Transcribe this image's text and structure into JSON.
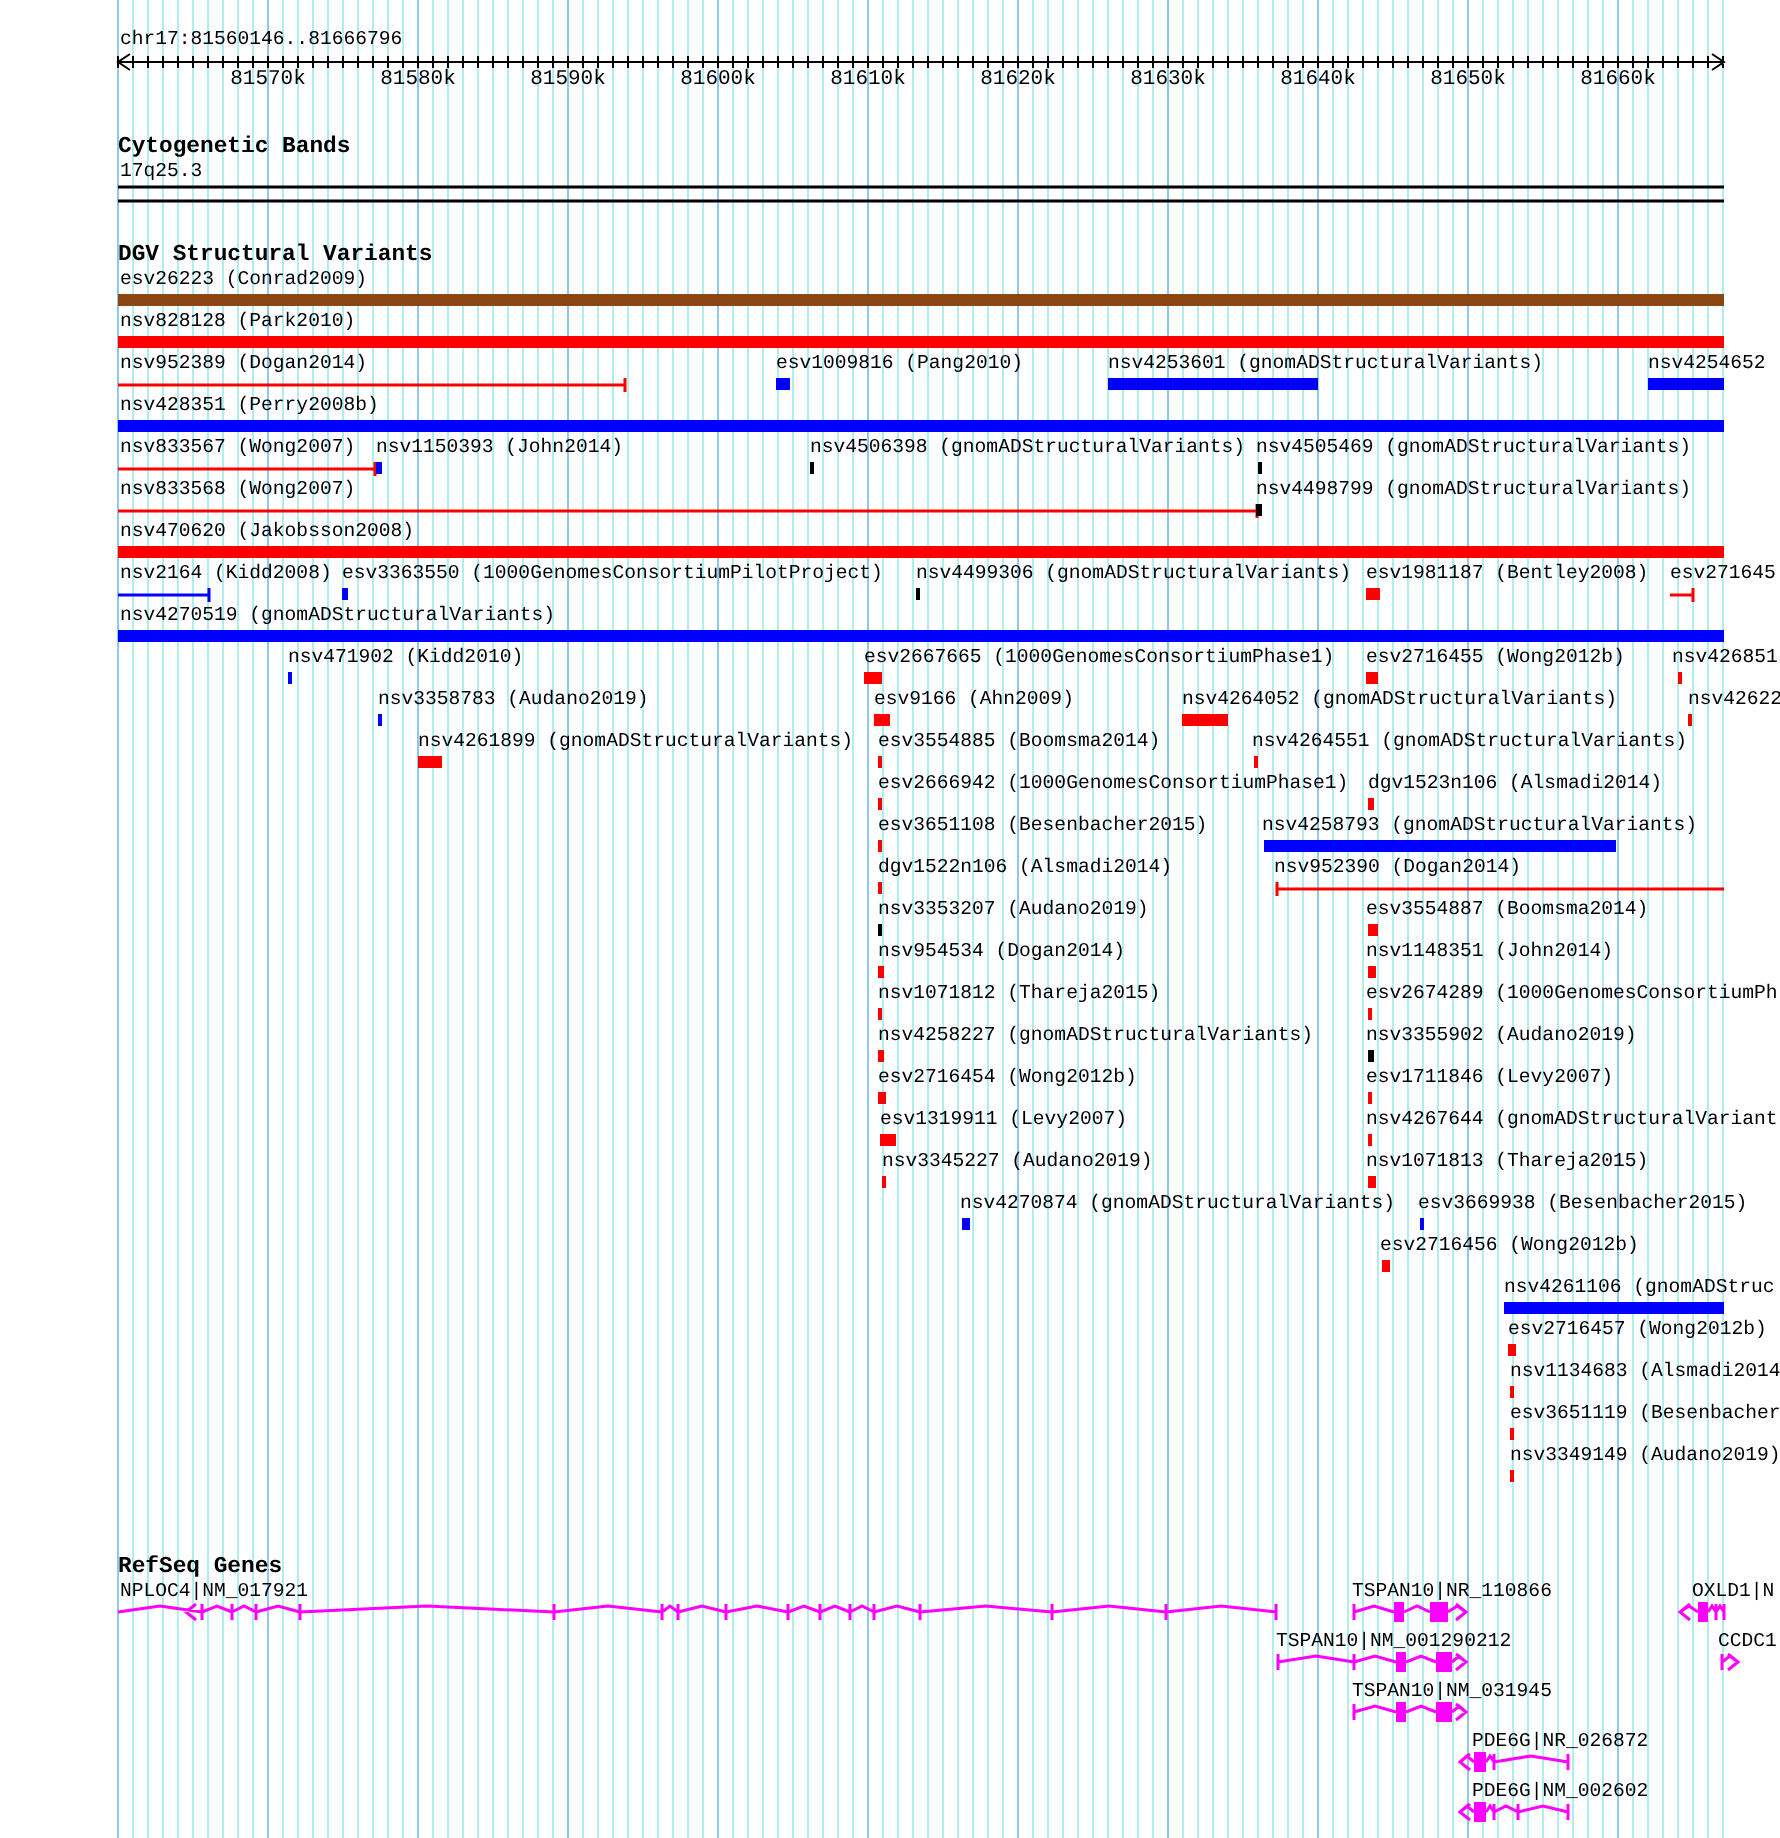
{
  "locus": "chr17:81560146..81666796",
  "ruler": {
    "ticks": [
      "81570k",
      "81580k",
      "81590k",
      "81600k",
      "81610k",
      "81620k",
      "81630k",
      "81640k",
      "81650k",
      "81660k"
    ]
  },
  "tracks": [
    {
      "title": "Cytogenetic Bands",
      "features": [
        {
          "label": "17q25.3"
        }
      ]
    },
    {
      "title": "DGV Structural Variants",
      "features": [
        {
          "label": "esv26223 (Conrad2009)",
          "color": "#8b4513"
        },
        {
          "label": "nsv828128 (Park2010)",
          "color": "#ff0000"
        },
        {
          "label": "nsv952389 (Dogan2014)",
          "color": "#ff0000"
        },
        {
          "label": "esv1009816 (Pang2010)",
          "color": "#0000ff"
        },
        {
          "label": "nsv4253601 (gnomADStructuralVariants)",
          "color": "#0000ff"
        },
        {
          "label": "nsv4254652",
          "color": "#0000ff"
        },
        {
          "label": "nsv428351 (Perry2008b)",
          "color": "#0000ff"
        },
        {
          "label": "nsv833567 (Wong2007)",
          "color": "#ff0000"
        },
        {
          "label": "nsv1150393 (John2014)",
          "color": "#0000ff"
        },
        {
          "label": "nsv4506398 (gnomADStructuralVariants)",
          "color": "#000000"
        },
        {
          "label": "nsv4505469 (gnomADStructuralVariants)",
          "color": "#000000"
        },
        {
          "label": "nsv833568 (Wong2007)",
          "color": "#ff0000"
        },
        {
          "label": "nsv4498799 (gnomADStructuralVariants)",
          "color": "#000000"
        },
        {
          "label": "nsv470620 (Jakobsson2008)",
          "color": "#ff0000"
        },
        {
          "label": "nsv2164 (Kidd2008)",
          "color": "#0000ff"
        },
        {
          "label": "esv3363550 (1000GenomesConsortiumPilotProject)",
          "color": "#0000ff"
        },
        {
          "label": "nsv4499306 (gnomADStructuralVariants)",
          "color": "#000000"
        },
        {
          "label": "esv1981187 (Bentley2008)",
          "color": "#ff0000"
        },
        {
          "label": "esv271645",
          "color": "#ff0000"
        },
        {
          "label": "nsv4270519 (gnomADStructuralVariants)",
          "color": "#0000ff"
        },
        {
          "label": "nsv471902 (Kidd2010)",
          "color": "#0000ff"
        },
        {
          "label": "esv2667665 (1000GenomesConsortiumPhase1)",
          "color": "#ff0000"
        },
        {
          "label": "esv2716455 (Wong2012b)",
          "color": "#ff0000"
        },
        {
          "label": "nsv426851",
          "color": "#ff0000"
        },
        {
          "label": "nsv3358783 (Audano2019)",
          "color": "#0000ff"
        },
        {
          "label": "esv9166 (Ahn2009)",
          "color": "#ff0000"
        },
        {
          "label": "nsv4264052 (gnomADStructuralVariants)",
          "color": "#ff0000"
        },
        {
          "label": "nsv42622",
          "color": "#ff0000"
        },
        {
          "label": "nsv4261899 (gnomADStructuralVariants)",
          "color": "#ff0000"
        },
        {
          "label": "esv3554885 (Boomsma2014)",
          "color": "#ff0000"
        },
        {
          "label": "nsv4264551 (gnomADStructuralVariants)",
          "color": "#ff0000"
        },
        {
          "label": "esv2666942 (1000GenomesConsortiumPhase1)",
          "color": "#ff0000"
        },
        {
          "label": "dgv1523n106 (Alsmadi2014)",
          "color": "#ff0000"
        },
        {
          "label": "esv3651108 (Besenbacher2015)",
          "color": "#ff0000"
        },
        {
          "label": "nsv4258793 (gnomADStructuralVariants)",
          "color": "#0000ff"
        },
        {
          "label": "dgv1522n106 (Alsmadi2014)",
          "color": "#ff0000"
        },
        {
          "label": "nsv952390 (Dogan2014)",
          "color": "#ff0000"
        },
        {
          "label": "nsv3353207 (Audano2019)",
          "color": "#000000"
        },
        {
          "label": "esv3554887 (Boomsma2014)",
          "color": "#ff0000"
        },
        {
          "label": "nsv954534 (Dogan2014)",
          "color": "#ff0000"
        },
        {
          "label": "nsv1148351 (John2014)",
          "color": "#ff0000"
        },
        {
          "label": "nsv1071812 (Thareja2015)",
          "color": "#ff0000"
        },
        {
          "label": "esv2674289 (1000GenomesConsortiumPh",
          "color": "#ff0000"
        },
        {
          "label": "nsv4258227 (gnomADStructuralVariants)",
          "color": "#ff0000"
        },
        {
          "label": "nsv3355902 (Audano2019)",
          "color": "#000000"
        },
        {
          "label": "esv2716454 (Wong2012b)",
          "color": "#ff0000"
        },
        {
          "label": "esv1711846 (Levy2007)",
          "color": "#ff0000"
        },
        {
          "label": "esv1319911 (Levy2007)",
          "color": "#ff0000"
        },
        {
          "label": "nsv4267644 (gnomADStructuralVariant",
          "color": "#ff0000"
        },
        {
          "label": "nsv3345227 (Audano2019)",
          "color": "#ff0000"
        },
        {
          "label": "nsv1071813 (Thareja2015)",
          "color": "#ff0000"
        },
        {
          "label": "nsv4270874 (gnomADStructuralVariants)",
          "color": "#0000ff"
        },
        {
          "label": "esv3669938 (Besenbacher2015)",
          "color": "#0000ff"
        },
        {
          "label": "esv2716456 (Wong2012b)",
          "color": "#ff0000"
        },
        {
          "label": "nsv4261106 (gnomADStruc",
          "color": "#0000ff"
        },
        {
          "label": "esv2716457 (Wong2012b)",
          "color": "#ff0000"
        },
        {
          "label": "nsv1134683 (Alsmadi2014",
          "color": "#ff0000"
        },
        {
          "label": "esv3651119 (Besenbacher",
          "color": "#ff0000"
        },
        {
          "label": "nsv3349149 (Audano2019)",
          "color": "#ff0000"
        }
      ]
    },
    {
      "title": "RefSeq Genes",
      "features": [
        {
          "label": "NPLOC4|NM_017921"
        },
        {
          "label": "TSPAN10|NR_110866"
        },
        {
          "label": "OXLD1|N"
        },
        {
          "label": "TSPAN10|NM_001290212"
        },
        {
          "label": "CCDC1"
        },
        {
          "label": "TSPAN10|NM_031945"
        },
        {
          "label": "PDE6G|NR_026872"
        },
        {
          "label": "PDE6G|NM_002602"
        }
      ]
    }
  ]
}
